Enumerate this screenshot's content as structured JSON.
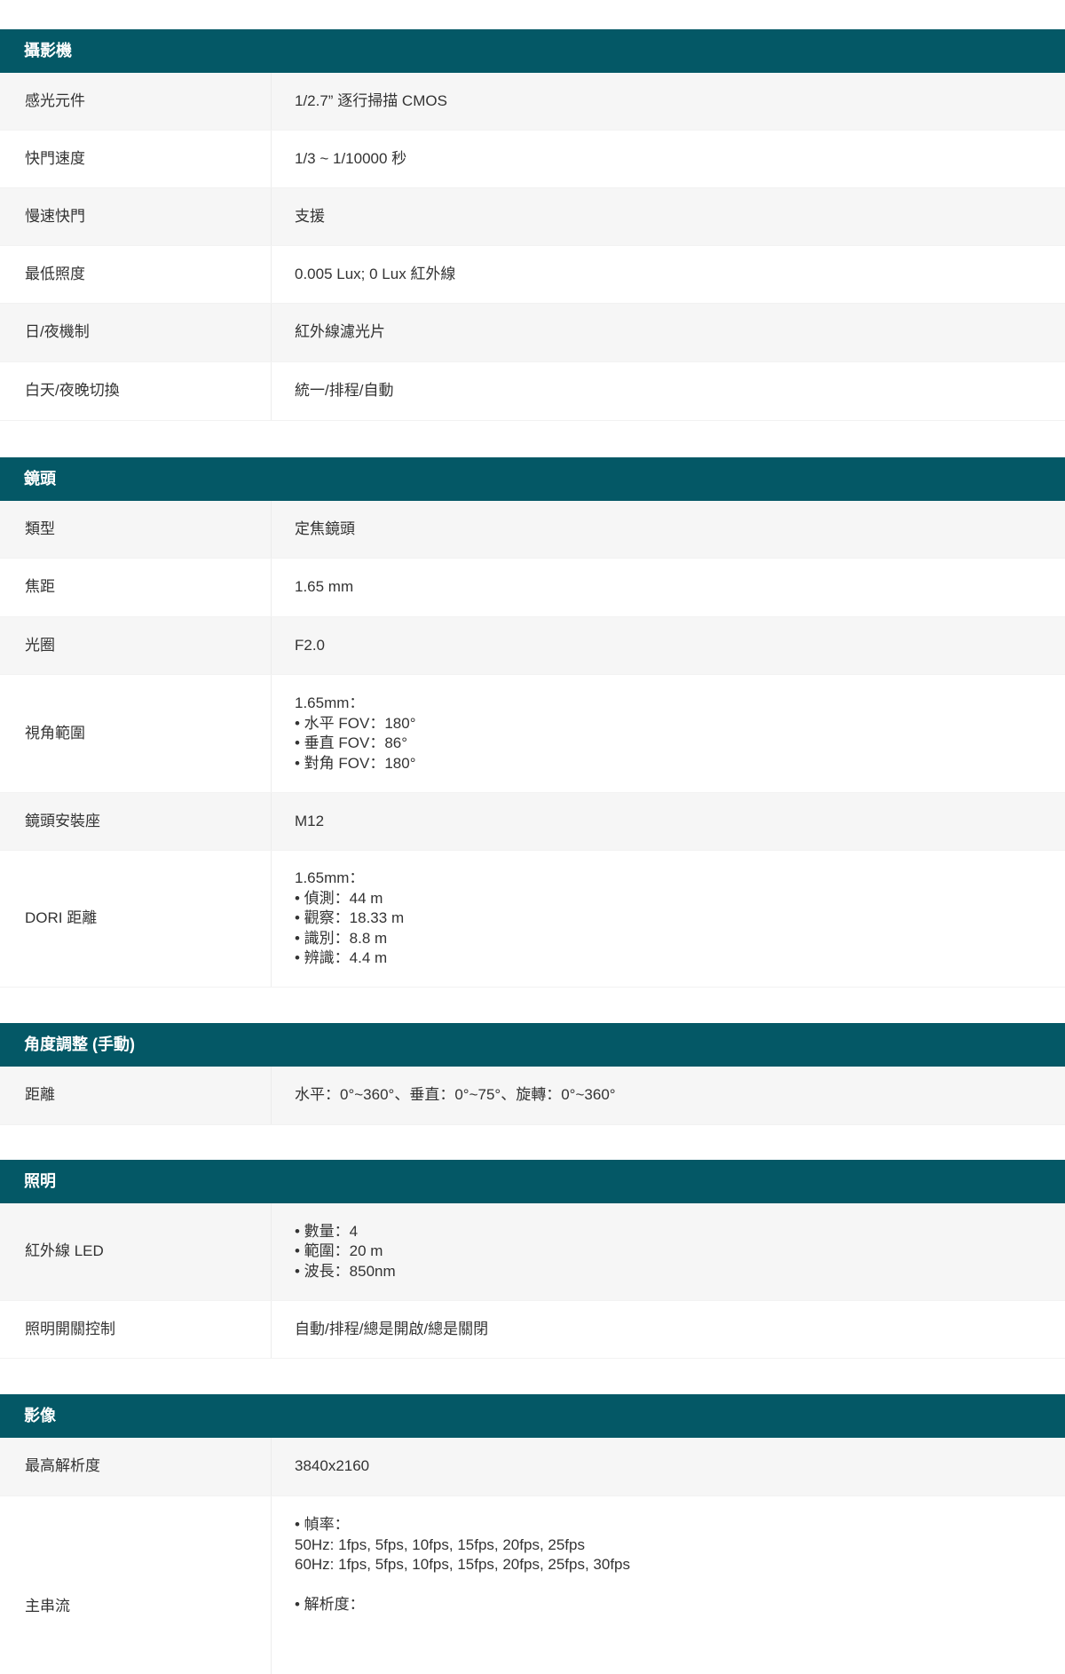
{
  "sections": [
    {
      "title": "攝影機",
      "rows": [
        {
          "label": "感光元件",
          "value": [
            "1/2.7” 逐行掃描 CMOS"
          ]
        },
        {
          "label": "快門速度",
          "value": [
            "1/3 ~ 1/10000 秒"
          ]
        },
        {
          "label": "慢速快門",
          "value": [
            "支援"
          ]
        },
        {
          "label": "最低照度",
          "value": [
            "0.005 Lux; 0 Lux 紅外線"
          ]
        },
        {
          "label": "日/夜機制",
          "value": [
            "紅外線濾光片"
          ]
        },
        {
          "label": "白天/夜晚切換",
          "value": [
            "統一/排程/自動"
          ]
        }
      ]
    },
    {
      "title": "鏡頭",
      "rows": [
        {
          "label": "類型",
          "value": [
            "定焦鏡頭"
          ]
        },
        {
          "label": "焦距",
          "value": [
            "1.65 mm"
          ]
        },
        {
          "label": "光圈",
          "value": [
            "F2.0"
          ]
        },
        {
          "label": "視角範圍",
          "value": [
            "1.65mm：",
            "• 水平 FOV：180°",
            "• 垂直 FOV：86°",
            "• 對角 FOV：180°"
          ]
        },
        {
          "label": "鏡頭安裝座",
          "value": [
            "M12"
          ]
        },
        {
          "label": "DORI 距離",
          "value": [
            "1.65mm：",
            "• 偵測：44 m",
            "• 觀察：18.33 m",
            "• 識別：8.8 m",
            "• 辨識：4.4 m"
          ]
        }
      ]
    },
    {
      "title": "角度調整 (手動)",
      "rows": [
        {
          "label": "距離",
          "value": [
            "水平：0°~360°、垂直：0°~75°、旋轉：0°~360°"
          ]
        }
      ]
    },
    {
      "title": "照明",
      "rows": [
        {
          "label": "紅外線 LED",
          "value": [
            "• 數量：4",
            "• 範圍：20 m",
            "• 波長：850nm"
          ]
        },
        {
          "label": "照明開關控制",
          "value": [
            "自動/排程/總是開啟/總是關閉"
          ]
        }
      ]
    },
    {
      "title": "影像",
      "rows": [
        {
          "label": "最高解析度",
          "value": [
            "3840x2160"
          ]
        },
        {
          "label": "主串流",
          "value": [
            "• 幀率：",
            "50Hz: 1fps, 5fps, 10fps, 15fps, 20fps, 25fps",
            "60Hz: 1fps, 5fps, 10fps, 15fps, 20fps, 25fps, 30fps",
            "",
            "• 解析度："
          ]
        }
      ]
    }
  ]
}
